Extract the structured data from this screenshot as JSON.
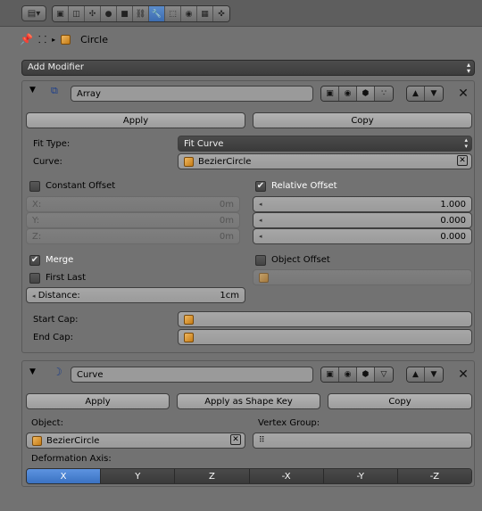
{
  "breadcrumb": {
    "object_name": "Circle"
  },
  "add_modifier_label": "Add Modifier",
  "array_mod": {
    "name": "Array",
    "apply_label": "Apply",
    "copy_label": "Copy",
    "fit_type_label": "Fit Type:",
    "fit_type_value": "Fit Curve",
    "curve_label": "Curve:",
    "curve_value": "BezierCircle",
    "constant_offset_label": "Constant Offset",
    "constant_offset_checked": false,
    "relative_offset_label": "Relative Offset",
    "relative_offset_checked": true,
    "constant": [
      {
        "axis": "X:",
        "value": "0m"
      },
      {
        "axis": "Y:",
        "value": "0m"
      },
      {
        "axis": "Z:",
        "value": "0m"
      }
    ],
    "relative": [
      "1.000",
      "0.000",
      "0.000"
    ],
    "merge_label": "Merge",
    "merge_checked": true,
    "object_offset_label": "Object Offset",
    "object_offset_checked": false,
    "first_last_label": "First Last",
    "first_last_checked": false,
    "distance_label": "Distance:",
    "distance_value": "1cm",
    "start_cap_label": "Start Cap:",
    "end_cap_label": "End Cap:"
  },
  "curve_mod": {
    "name": "Curve",
    "apply_label": "Apply",
    "apply_shape_label": "Apply as Shape Key",
    "copy_label": "Copy",
    "object_label": "Object:",
    "object_value": "BezierCircle",
    "vertex_group_label": "Vertex Group:",
    "deformation_axis_label": "Deformation Axis:",
    "axes": [
      "X",
      "Y",
      "Z",
      "-X",
      "-Y",
      "-Z"
    ],
    "selected_axis": "X"
  },
  "colors": {
    "accent": "#4a82d0",
    "panel": "#727272"
  }
}
